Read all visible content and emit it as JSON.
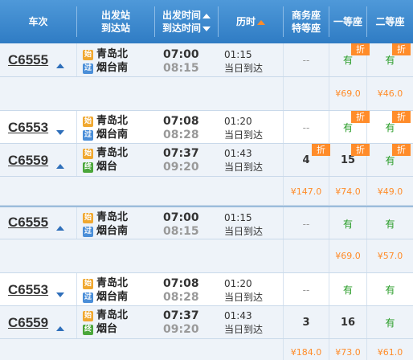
{
  "header": {
    "train": "车次",
    "from_station": "出发站",
    "to_station": "到达站",
    "dep_time": "出发时间",
    "arr_time": "到达时间",
    "duration": "历时",
    "business": "商务座",
    "special": "特等座",
    "first": "一等座",
    "second": "二等座"
  },
  "discount_label": "折",
  "rows": [
    {
      "train": "C6555",
      "from": "青岛北",
      "to": "烟台南",
      "from_badge": "始",
      "to_badge": "过",
      "dep": "07:00",
      "arr": "08:15",
      "duration": "01:15",
      "arrival_day": "当日到达",
      "business": "--",
      "first": "有",
      "second": "有",
      "price_first": "¥69.0",
      "price_second": "¥46.0"
    },
    {
      "train": "C6553",
      "from": "青岛北",
      "to": "烟台南",
      "from_badge": "始",
      "to_badge": "过",
      "dep": "07:08",
      "arr": "08:28",
      "duration": "01:20",
      "arrival_day": "当日到达",
      "business": "--",
      "first": "有",
      "second": "有"
    },
    {
      "train": "C6559",
      "from": "青岛北",
      "to": "烟台",
      "from_badge": "始",
      "to_badge": "终",
      "dep": "07:37",
      "arr": "09:20",
      "duration": "01:43",
      "arrival_day": "当日到达",
      "business": "4",
      "first": "15",
      "second": "有",
      "price_business": "¥147.0",
      "price_first": "¥74.0",
      "price_second": "¥49.0"
    },
    {
      "train": "C6555",
      "from": "青岛北",
      "to": "烟台南",
      "from_badge": "始",
      "to_badge": "过",
      "dep": "07:00",
      "arr": "08:15",
      "duration": "01:15",
      "arrival_day": "当日到达",
      "business": "--",
      "first": "有",
      "second": "有",
      "price_first": "¥69.0",
      "price_second": "¥57.0"
    },
    {
      "train": "C6553",
      "from": "青岛北",
      "to": "烟台南",
      "from_badge": "始",
      "to_badge": "过",
      "dep": "07:08",
      "arr": "08:28",
      "duration": "01:20",
      "arrival_day": "当日到达",
      "business": "--",
      "first": "有",
      "second": "有"
    },
    {
      "train": "C6559",
      "from": "青岛北",
      "to": "烟台",
      "from_badge": "始",
      "to_badge": "终",
      "dep": "07:37",
      "arr": "09:20",
      "duration": "01:43",
      "arrival_day": "当日到达",
      "business": "3",
      "first": "16",
      "second": "有",
      "price_business": "¥184.0",
      "price_first": "¥73.0",
      "price_second": "¥61.0"
    }
  ],
  "colors": {
    "header_bg": "#2f7cc4",
    "available": "#259b24",
    "price": "#ff8c2a",
    "discount_badge": "#ff8c2a"
  }
}
